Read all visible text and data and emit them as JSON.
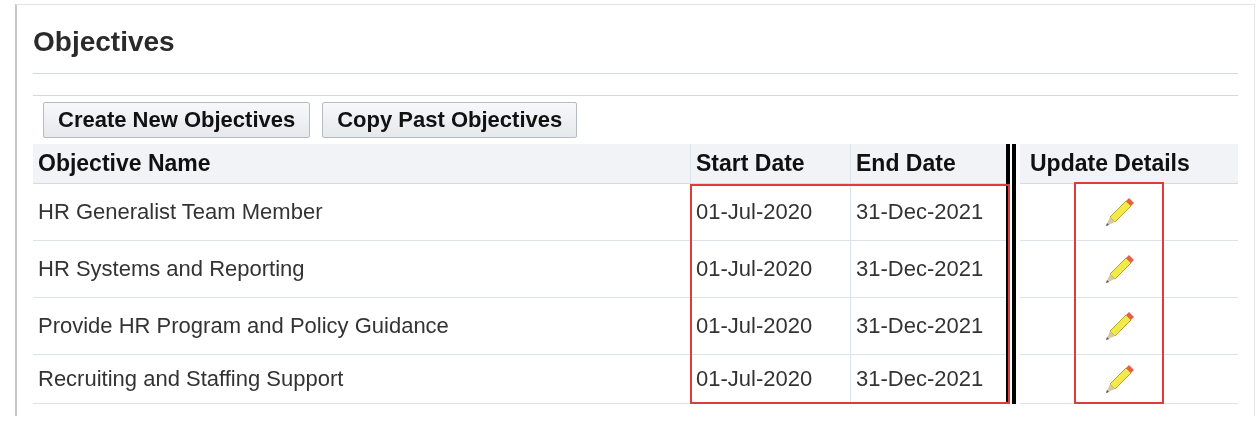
{
  "title": "Objectives",
  "buttons": [
    "Create New Objectives",
    "Copy Past Objectives"
  ],
  "table": {
    "columns": [
      "Objective Name",
      "Start Date",
      "End Date",
      "Update Details"
    ],
    "rows": [
      {
        "name": "HR Generalist Team Member",
        "start_date": "01-Jul-2020",
        "end_date": "31-Dec-2021"
      },
      {
        "name": "HR Systems and Reporting",
        "start_date": "01-Jul-2020",
        "end_date": "31-Dec-2021"
      },
      {
        "name": "Provide HR Program and Policy Guidance",
        "start_date": "01-Jul-2020",
        "end_date": "31-Dec-2021"
      },
      {
        "name": "Recruiting and Staffing Support",
        "start_date": "01-Jul-2020",
        "end_date": "31-Dec-2021"
      }
    ]
  }
}
